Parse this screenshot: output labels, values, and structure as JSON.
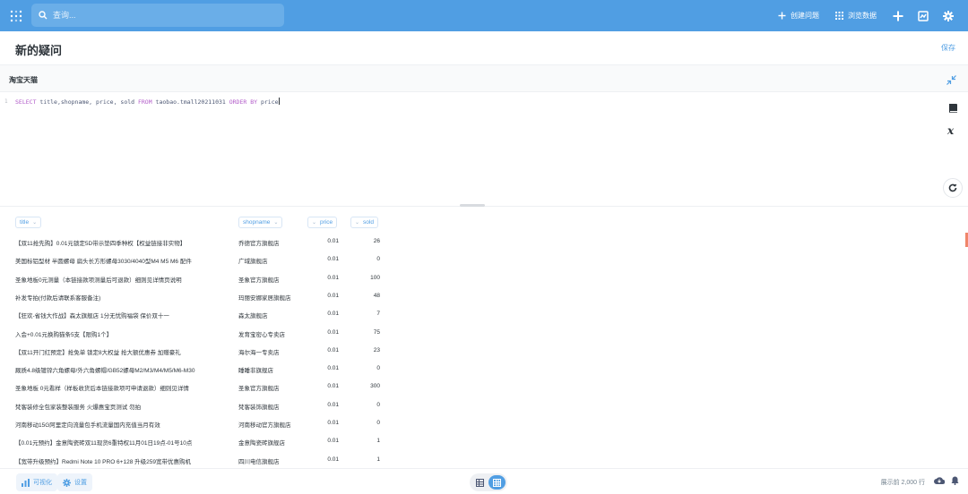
{
  "nav": {
    "logo_icon": "metabase-logo-icon",
    "search_placeholder": "查询...",
    "create_question_label": "创建问题",
    "browse_data_label": "浏览数据",
    "accent_color": "#509ee3"
  },
  "page": {
    "title": "新的疑问",
    "save_label": "保存"
  },
  "database": {
    "name": "淘宝天猫"
  },
  "editor": {
    "line_number": "1",
    "sql_parts": [
      {
        "text": "SELECT",
        "kw": true
      },
      {
        "text": " title,shopname, price, sold ",
        "kw": false
      },
      {
        "text": "FROM",
        "kw": true
      },
      {
        "text": " taobao.tmall20211031 ",
        "kw": false
      },
      {
        "text": "ORDER BY",
        "kw": true
      },
      {
        "text": " price",
        "kw": false
      }
    ]
  },
  "table": {
    "columns": [
      "title",
      "shopname",
      "price",
      "sold"
    ],
    "rows": [
      [
        "【双11抢先购】0.01元锁定5D带示垫四季种权【权益链接非实物】",
        "乔德官方旗舰店",
        "0.01",
        "26"
      ],
      [
        "美国标铝型材 半圆螺母 扁头长方形螺母3030/4040型M4 M5 M6 配件",
        "广域旗舰店",
        "0.01",
        "0"
      ],
      [
        "圣象地板0元测量（本链接款项测量后可退款）细则见详情页说明",
        "圣象官方旗舰店",
        "0.01",
        "100"
      ],
      [
        "补发专拍(付款后请联系客服备注)",
        "玛丽安娜家居旗舰店",
        "0.01",
        "48"
      ],
      [
        "【狂欢-省钱大作战】森太旗舰店 1分无忧购福袋 保价双十一",
        "森太旗舰店",
        "0.01",
        "7"
      ],
      [
        "入会+0.01元换购猫条5支【限购1个】",
        "发育宝密心专卖店",
        "0.01",
        "75"
      ],
      [
        "【双11开门红预定】抢免单 锁定8大权益 抢大额优惠券 加赠豪礼",
        "海尔海一专卖店",
        "0.01",
        "23"
      ],
      [
        "厩质4.8级镀锌六角螺母/外六角螺帽/GB52螺母M2/M3/M4/M5/M6-M30",
        "睡睡非旗舰店",
        "0.01",
        "0"
      ],
      [
        "圣象地板 0元看样（样板收货后本链接款项可申请退款）细则见详情",
        "圣象官方旗舰店",
        "0.01",
        "300"
      ],
      [
        "梵客装修全包家装整装服务 火爆惠宝页测试 勿拍",
        "梵客装饰旗舰店",
        "0.01",
        "0"
      ],
      [
        "河南移动15G阿里定向流量包手机流量国内充值当月有效",
        "河南移动官方旗舰店",
        "0.01",
        "0"
      ],
      [
        "【0.01元预约】金意陶瓷砖双11现货6重特权11月01日19点-01号10点",
        "金意陶瓷砖旗舰店",
        "0.01",
        "1"
      ],
      [
        "【宽带升级预约】Redmi Note 10 PRO 6+128 升级259宽带优惠购机",
        "四川电信旗舰店",
        "0.01",
        "1"
      ]
    ]
  },
  "footer": {
    "visualize_label": "可视化",
    "settings_label": "设置",
    "row_count_text": "展示前 2,000 行"
  }
}
